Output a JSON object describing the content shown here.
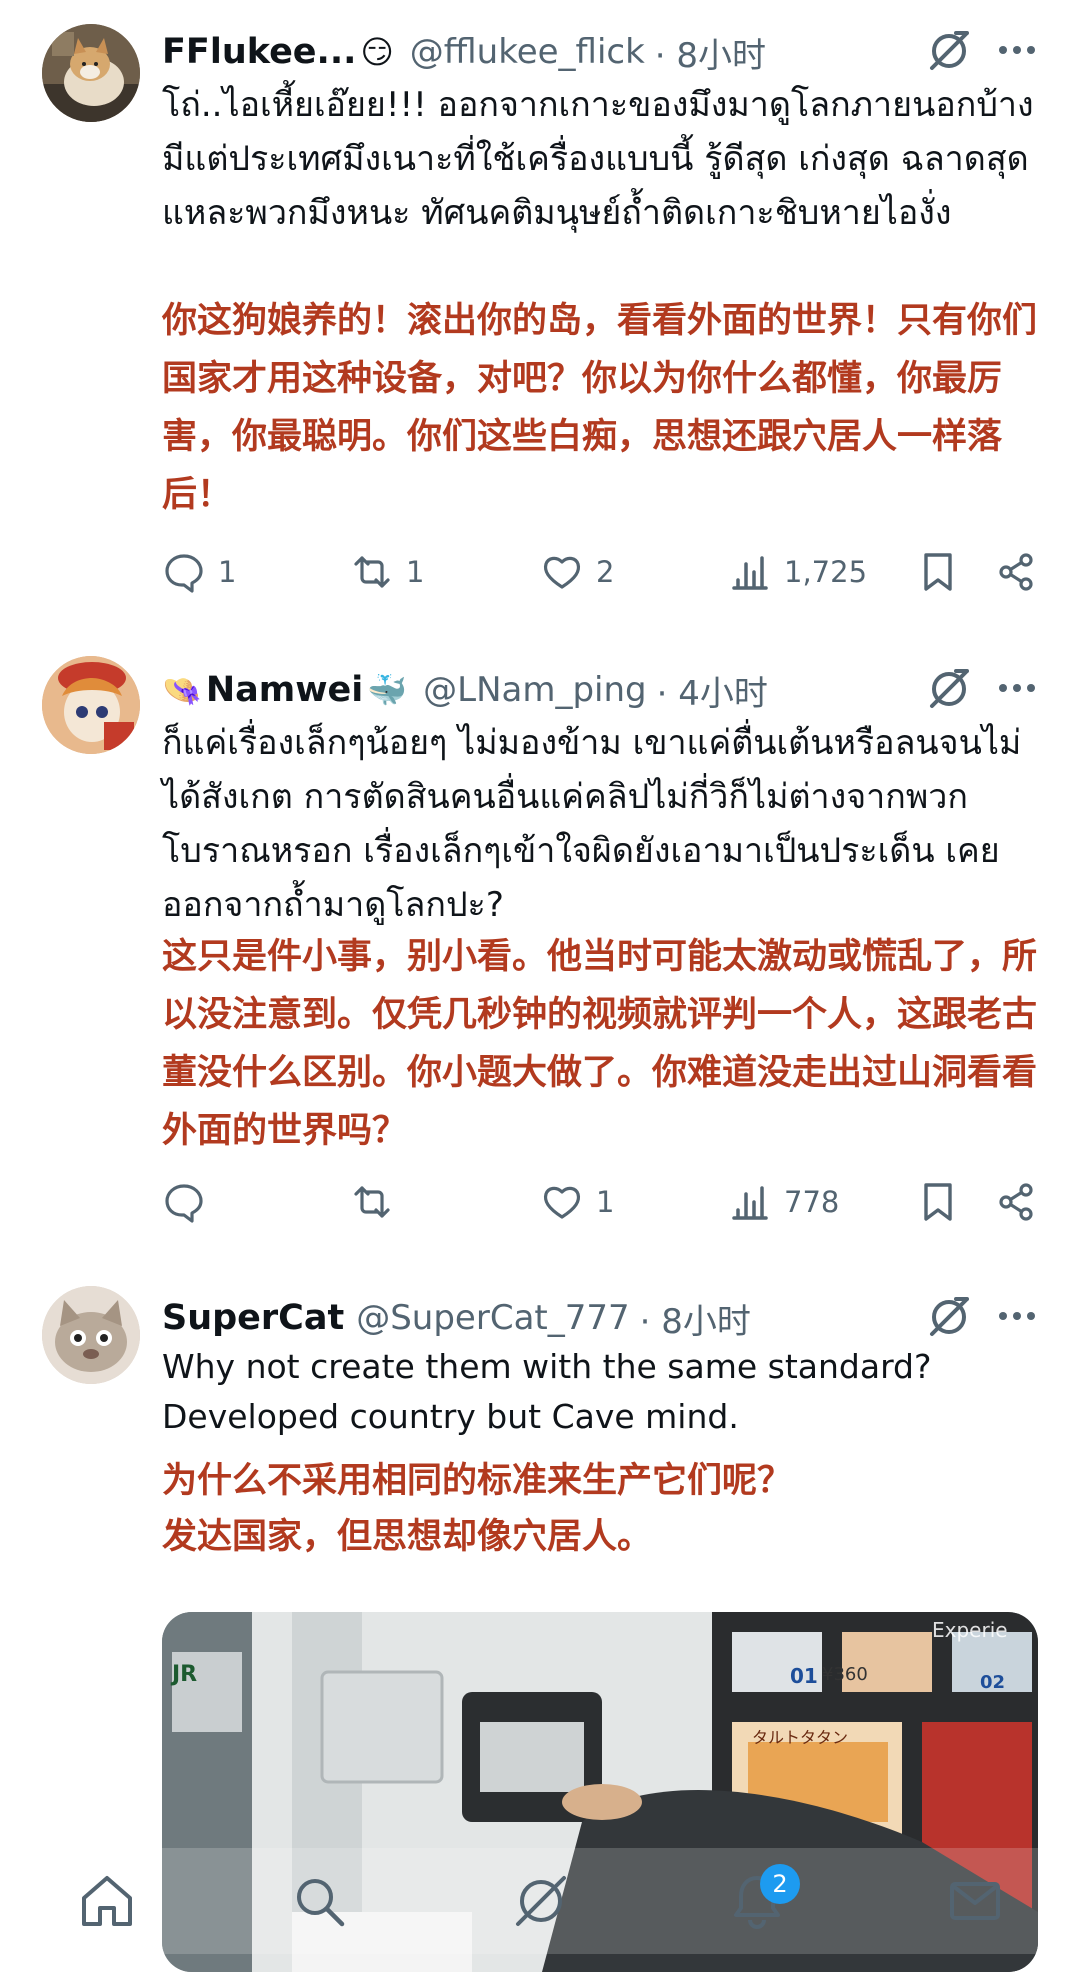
{
  "posts": [
    {
      "display_name": "FFlukee...",
      "emoji": "😏",
      "handle": "@fflukee_flick",
      "time": "· 8小时",
      "thai": "โถ่..ไอเหี้ยเอ๊ยย!!! ออกจากเกาะของมึงมาดูโลกภายนอกบ้าง มีแต่ประเทศมึงเนาะที่ใช้เครื่องแบบนี้ รู้ดีสุด เก่งสุด ฉลาดสุดแหละพวกมึงหนะ ทัศนคติมนุษย์ถ้ำติดเกาะชิบหายไองั่ง",
      "translation": "你这狗娘养的！滚出你的岛，看看外面的世界！只有你们国家才用这种设备，对吧？你以为你什么都懂，你最厉害，你最聪明。你们这些白痴，思想还跟穴居人一样落后！",
      "stats": {
        "replies": "1",
        "reposts": "1",
        "likes": "2",
        "views": "1,725"
      }
    },
    {
      "display_name_prefix": "👒",
      "display_name": "Namwei",
      "emoji": "🐳",
      "handle": "@LNam_ping",
      "time": "· 4小时",
      "thai": "ก็แค่เรื่องเล็กๆน้อยๆ ไม่มองข้าม เขาแค่ตื่นเต้นหรือลนจนไม่ได้สังเกต การตัดสินคนอื่นแค่คลิปไม่กี่วิก็ไม่ต่างจากพวกโบราณหรอก เรื่องเล็กๆเข้าใจผิดยังเอามาเป็นประเด็น เคยออกจากถ้ำมาดูโลกปะ?",
      "translation": "这只是件小事，别小看。他当时可能太激动或慌乱了，所以没注意到。仅凭几秒钟的视频就评判一个人，这跟老古董没什么区别。你小题大做了。你难道没走出过山洞看看外面的世界吗？",
      "stats": {
        "replies": "",
        "reposts": "",
        "likes": "1",
        "views": "778"
      }
    },
    {
      "display_name": "SuperCat",
      "handle": "@SuperCat_777",
      "time": "· 8小时",
      "english": "Why not create them with the same standard? Developed country but Cave mind.",
      "translation_line1": "为什么不采用相同的标准来生产它们呢？",
      "translation_line2": "发达国家，但思想却像穴居人。",
      "media_text": {
        "jr": "JR",
        "ticket1": "01",
        "price1": "¥360",
        "ticket2": "02",
        "product_jp": "タルトタタン",
        "watermark": "Experie"
      }
    }
  ],
  "nav": {
    "notification_count": "2"
  },
  "colors": {
    "translation": "#b23a1f",
    "muted": "#536471",
    "accent": "#1d9bf0"
  }
}
